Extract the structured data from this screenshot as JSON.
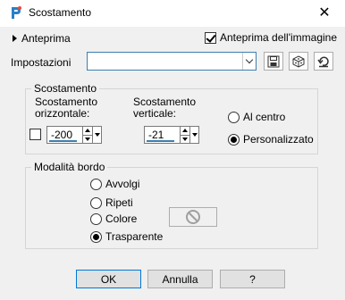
{
  "window": {
    "title": "Scostamento",
    "close_glyph": "✕"
  },
  "preview": {
    "toggle_label": "Anteprima",
    "live_label": "Anteprima dell'immagine",
    "live_checked": true
  },
  "presets": {
    "label": "Impostazioni",
    "value": ""
  },
  "offset": {
    "group_title": "Scostamento",
    "horizontal_label_line1": "Scostamento",
    "horizontal_label_line2": "orizzontale:",
    "horizontal_value": "-200",
    "vertical_label_line1": "Scostamento",
    "vertical_label_line2": "verticale:",
    "vertical_value": "-21",
    "center_label": "Al centro",
    "custom_label": "Personalizzato",
    "selected": "custom"
  },
  "edge_mode": {
    "group_title": "Modalità bordo",
    "wrap_label": "Avvolgi",
    "repeat_label": "Ripeti",
    "color_label": "Colore",
    "transparent_label": "Trasparente",
    "selected": "transparent"
  },
  "buttons": {
    "ok": "OK",
    "cancel": "Annulla",
    "help": "?"
  },
  "icons": [
    "app-icon",
    "close-icon",
    "disclosure-triangle-icon",
    "chevron-down-icon",
    "save-icon",
    "randomize-icon",
    "reset-icon",
    "spin-up-icon",
    "spin-down-icon",
    "dropper-icon",
    "no-color-icon"
  ],
  "colors": {
    "accent": "#3c7fb1",
    "dialog_bg": "#f0f0f0",
    "default_button_border": "#0078d7"
  }
}
